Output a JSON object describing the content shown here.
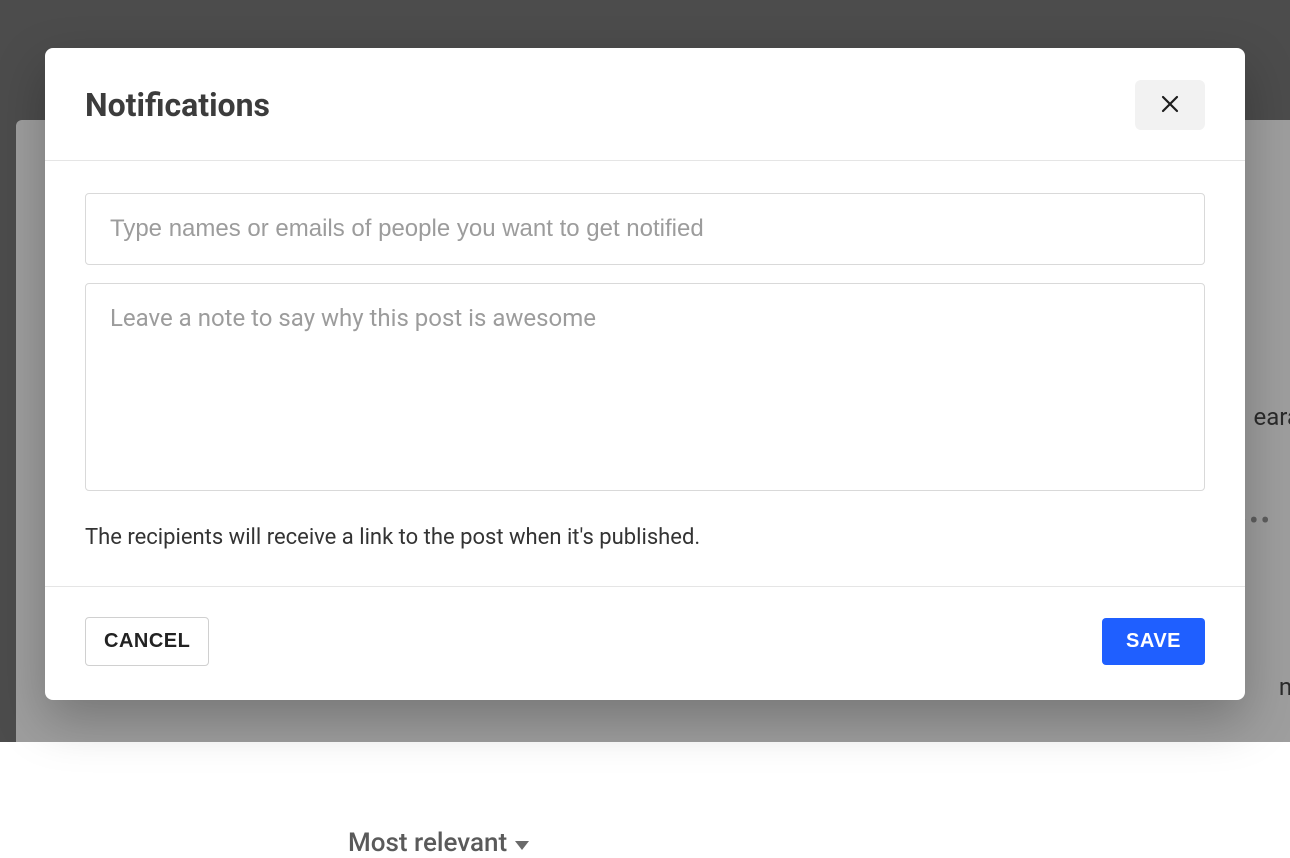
{
  "background": {
    "right_text_1": "eara",
    "right_text_2": "nt",
    "dots": "•••",
    "sort_label": "Most relevant"
  },
  "modal": {
    "title": "Notifications",
    "recipients_placeholder": "Type names or emails of people you want to get notified",
    "note_placeholder": "Leave a note to say why this post is awesome",
    "info_text": "The recipients will receive a link to the post when it's published.",
    "cancel_label": "CANCEL",
    "save_label": "SAVE"
  }
}
